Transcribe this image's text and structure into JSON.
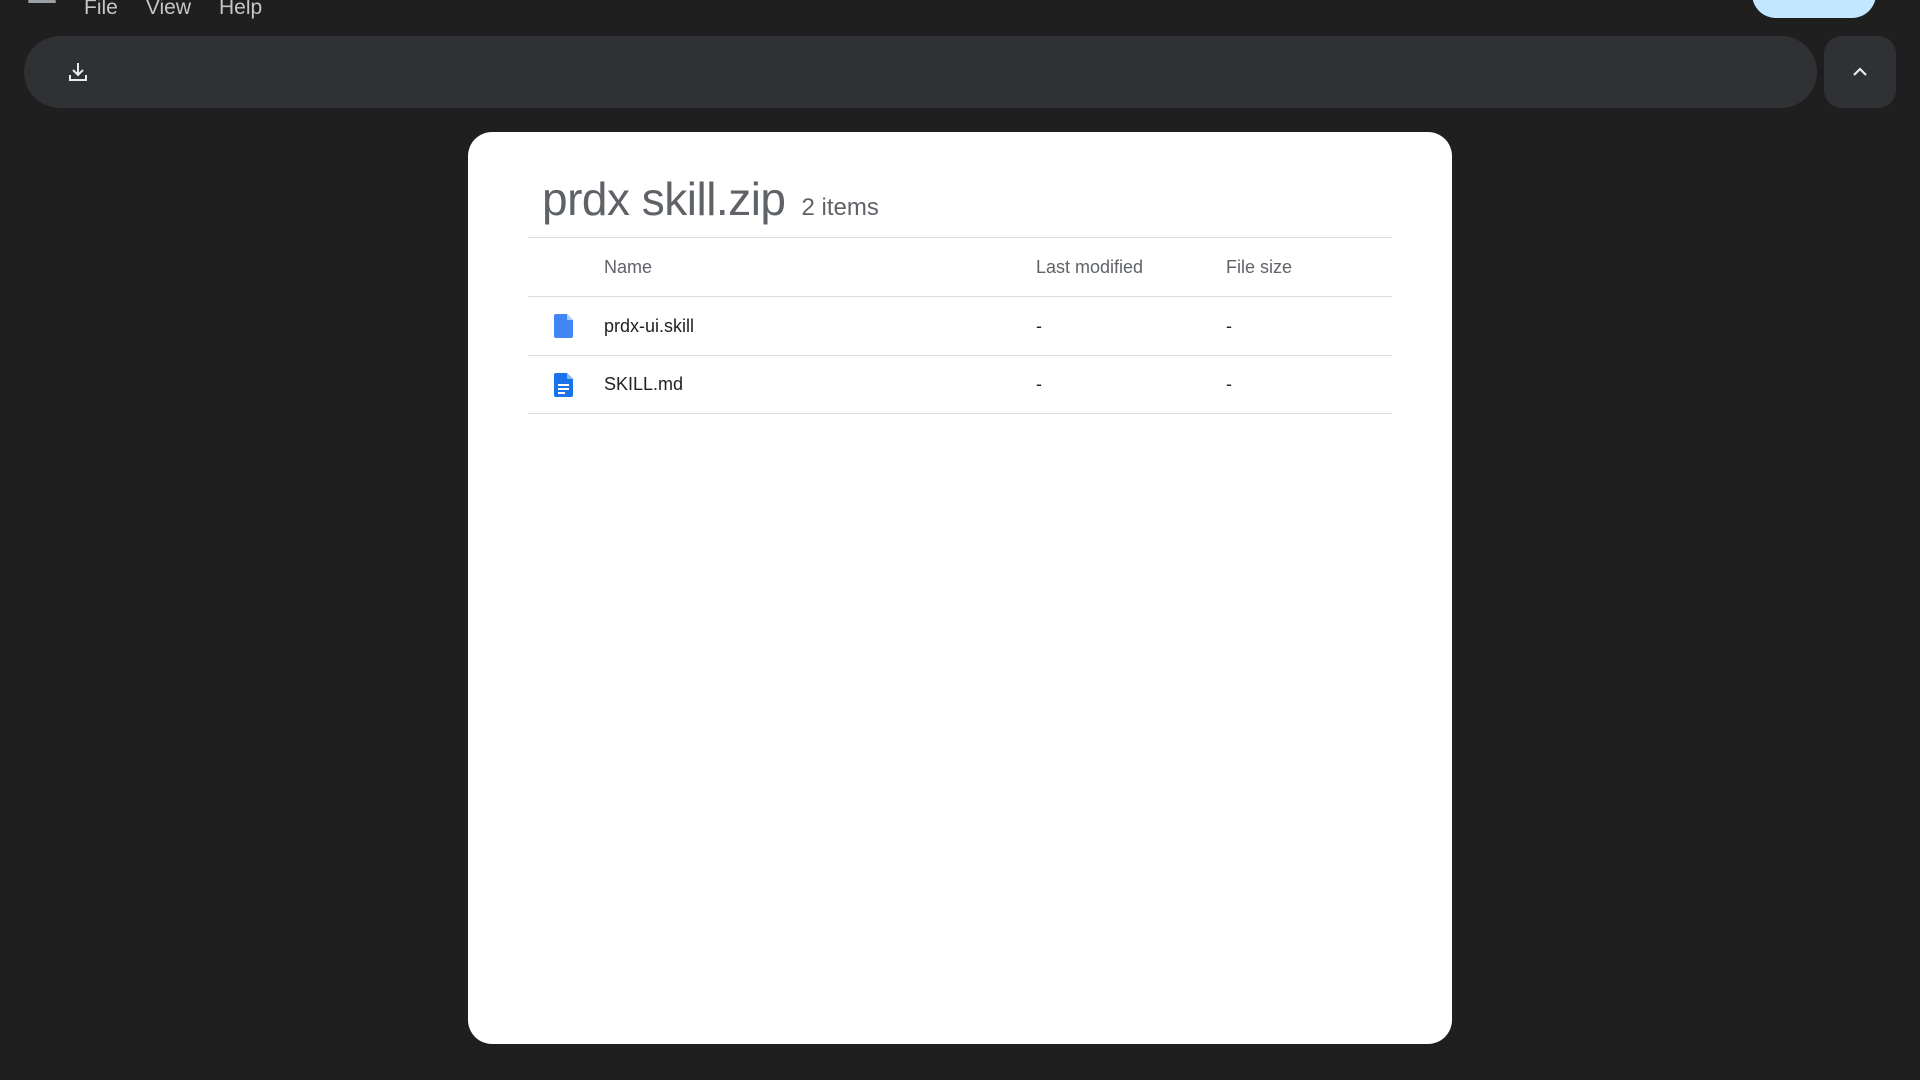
{
  "menu": {
    "items": [
      "File",
      "View",
      "Help"
    ]
  },
  "toolbar": {
    "download_icon": "download-icon",
    "collapse_icon": "chevron-up-icon"
  },
  "archive": {
    "title": "prdx skill.zip",
    "count": "2 items"
  },
  "table": {
    "columns": {
      "name": "Name",
      "modified": "Last modified",
      "size": "File size"
    },
    "rows": [
      {
        "icon": "generic-file-icon",
        "name": "prdx-ui.skill",
        "modified": "-",
        "size": "-"
      },
      {
        "icon": "document-file-icon",
        "name": "SKILL.md",
        "modified": "-",
        "size": "-"
      }
    ]
  },
  "colors": {
    "background": "#1f1f1f",
    "toolbar": "#303134",
    "card": "#ffffff",
    "file_icon": "#4285f4",
    "doc_icon": "#1a73e8",
    "share_button": "#c2e7ff"
  }
}
